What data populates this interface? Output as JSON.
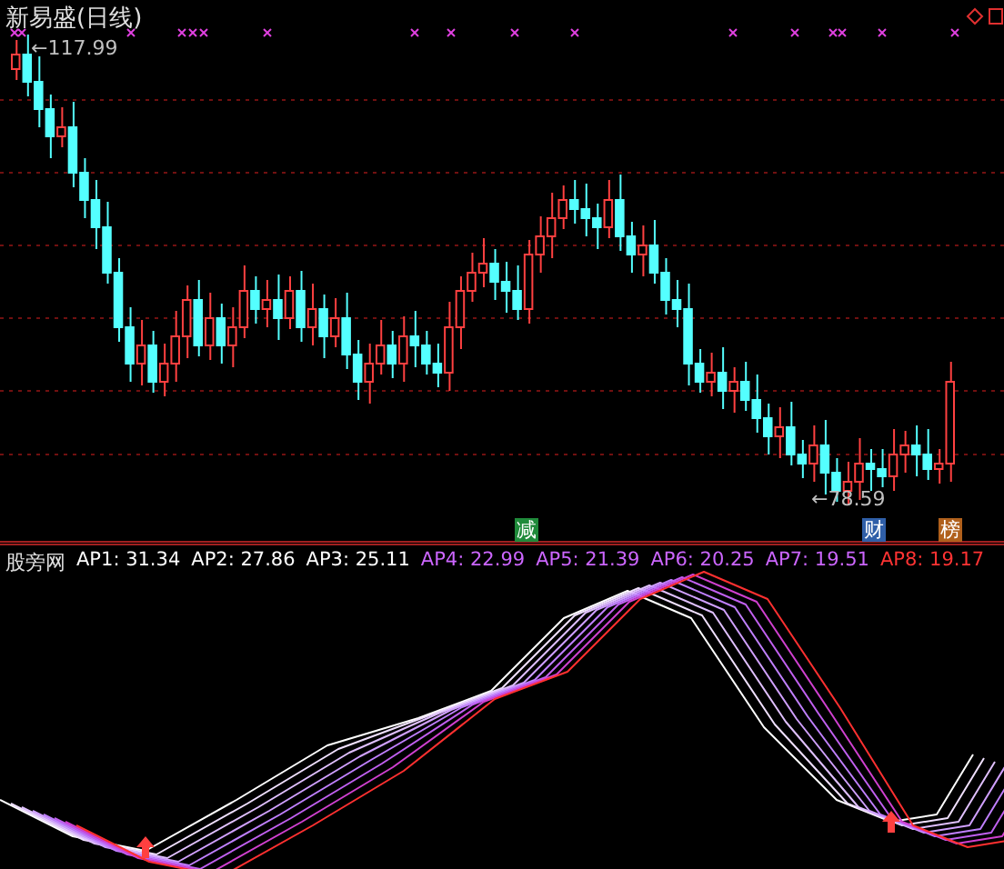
{
  "title": "新易盛(日线)",
  "price_high": "←117.99",
  "price_low": "←78.59",
  "signals": [
    {
      "text": "减",
      "color": "#1f8a3a"
    },
    {
      "text": "财",
      "color": "#2f5fa8"
    },
    {
      "text": "榜",
      "color": "#b0601c"
    }
  ],
  "indicator": {
    "name": "股旁网",
    "values": [
      {
        "label": "AP1: 31.34",
        "color": "#ffffff"
      },
      {
        "label": "AP2: 27.86",
        "color": "#ffffff"
      },
      {
        "label": "AP3: 25.11",
        "color": "#ffffff"
      },
      {
        "label": "AP4: 22.99",
        "color": "#cc66ff"
      },
      {
        "label": "AP5: 21.39",
        "color": "#cc66ff"
      },
      {
        "label": "AP6: 20.25",
        "color": "#cc66ff"
      },
      {
        "label": "AP7: 19.51",
        "color": "#cc66ff"
      },
      {
        "label": "AP8: 19.17",
        "color": "#ff3333"
      }
    ]
  }
}
